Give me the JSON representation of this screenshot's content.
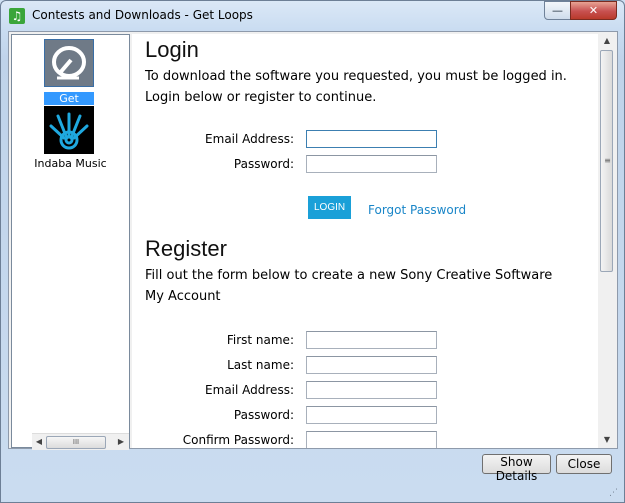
{
  "window": {
    "title": "Contests and Downloads - Get Loops",
    "min_label": "—",
    "close_label": "✕",
    "app_icon": "music-note-icon"
  },
  "sidebar": {
    "items": [
      {
        "label": "Get Loops",
        "icon": "get-loops-logo",
        "selected": true
      },
      {
        "label": "Indaba Music",
        "icon": "indaba-logo",
        "selected": false
      }
    ],
    "hscroll_grip": "III"
  },
  "login": {
    "heading": "Login",
    "intro": "To download the software you requested, you must be logged in. Login below or register to continue.",
    "email_label": "Email Address:",
    "email_value": "",
    "password_label": "Password:",
    "password_value": "",
    "login_button": "LOGIN",
    "forgot_link": "Forgot Password"
  },
  "register": {
    "heading": "Register",
    "intro": "Fill out the form below to create a new Sony Creative Software My Account",
    "fields": [
      {
        "label": "First name:",
        "value": ""
      },
      {
        "label": "Last name:",
        "value": ""
      },
      {
        "label": "Email Address:",
        "value": ""
      },
      {
        "label": "Password:",
        "value": ""
      },
      {
        "label": "Confirm Password:",
        "value": ""
      }
    ]
  },
  "buttons": {
    "show_details": "Show Details",
    "close": "Close"
  },
  "colors": {
    "accent_button": "#1aa0d8",
    "link": "#1a86c8",
    "selection": "#3399ff"
  }
}
